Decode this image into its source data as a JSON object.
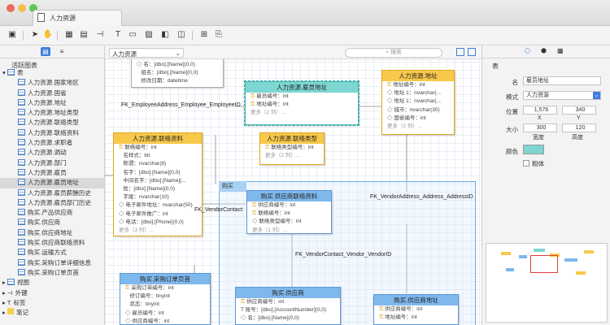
{
  "window": {
    "tab_title": "人力资源"
  },
  "sidebar": {
    "header": "活跃图表",
    "group_label": "表",
    "items": [
      "人力资源.国家地区",
      "人力资源.国省",
      "人力资源.地址",
      "人力资源.地址类型",
      "人力资源.联络类型",
      "人力资源.联络资料",
      "人力资源.求职者",
      "人力资源.调动",
      "人力资源.部门",
      "人力资源.雇员",
      "人力资源.雇员地址",
      "人力资源.雇员薪酬历史",
      "人力资源.雇员部门历史",
      "购买.产品供应商",
      "购买.供应商",
      "购买.供应商地址",
      "购买.供应商联络资料",
      "购买.运输方式",
      "购买.采购订单详细信息",
      "购买.采购订单页首"
    ],
    "bottom": [
      "视图",
      "外键",
      "标签",
      "笔记"
    ]
  },
  "canvas": {
    "schema_select": "人力资源",
    "search_placeholder": "搜索",
    "group_label": "购买"
  },
  "entities": {
    "top_partial": {
      "rows": [
        "名：[dbo].[Name](0,0)",
        "组名：[dbo].[Name](0,0)",
        "修改日期：datetime"
      ]
    },
    "emp_addr": {
      "title": "人力资源.雇员地址",
      "rows": [
        "雇员编号：int",
        "地址编号：int"
      ],
      "more": "更多（2 列）..."
    },
    "address": {
      "title": "人力资源.地址",
      "rows": [
        "地址编号：int",
        "地址 1：nvarchar(...",
        "地址 1：nvarchar(...",
        "城市：nvarchar(30)",
        "国省编号：int"
      ],
      "more": "更多（2 列）..."
    },
    "contact": {
      "title": "人力资源.联络资料",
      "rows": [
        "联络编号：int",
        "名样式：bit",
        "称谓：nvarchar(8)",
        "名字：[dbo].[Name](0,0)",
        "中间名字：[dbo].[Name](...",
        "姓：[dbo].[Name](0,0)",
        "字尾：nvarchar(10)",
        "电子邮件地址：nvarchar(50)",
        "电子邮件推广：int",
        "电话：[dbo].[Phone](0,0)"
      ],
      "more": "更多（3 列）..."
    },
    "contact_type": {
      "title": "人力资源.联络类型",
      "rows": [
        "联络类型编号：int"
      ],
      "more": "更多（2 列）..."
    },
    "vendor_contact": {
      "title": "购买.供应商联络资料",
      "rows": [
        "供应商编号：int",
        "联络编号：int",
        "联络类型编号：int"
      ],
      "more": "更多（1 列）..."
    },
    "po_header": {
      "title": "购买.采购订单页首",
      "rows": [
        "采购订单编号：int",
        "修订编号：tinyint",
        "状态：tinyint",
        "雇员编号：int",
        "供应商编号：int"
      ]
    },
    "vendor": {
      "title": "购买.供应商",
      "rows": [
        "供应商编号：int",
        "账号：[dbo].[AccountNumber](0,0)",
        "名：[dbo].[Name](0,0)"
      ]
    },
    "vendor_addr": {
      "title": "购买.供应商地址",
      "rows": [
        "供应商编号：int",
        "地址编号：int"
      ]
    }
  },
  "relations": {
    "r1": "FK_EmployeeAddress_Employee_EmployeeID",
    "r2": "FK_VendorAddress_Address_AddressID",
    "r3": "FK_VendorContact",
    "r4": "FK_VendorContact_Vendor_VendorID"
  },
  "properties": {
    "section": "表",
    "name_label": "名",
    "name_value": "雇员地址",
    "schema_label": "模式",
    "schema_value": "人力资源",
    "pos_label": "位置",
    "pos_x": "1,576",
    "pos_y": "340",
    "x_label": "X",
    "y_label": "Y",
    "size_label": "大小",
    "width": "300",
    "height": "120",
    "width_label": "宽度",
    "height_label": "高度",
    "color_label": "颜色",
    "color": "#7dd6d2",
    "bold_label": "粗体"
  }
}
